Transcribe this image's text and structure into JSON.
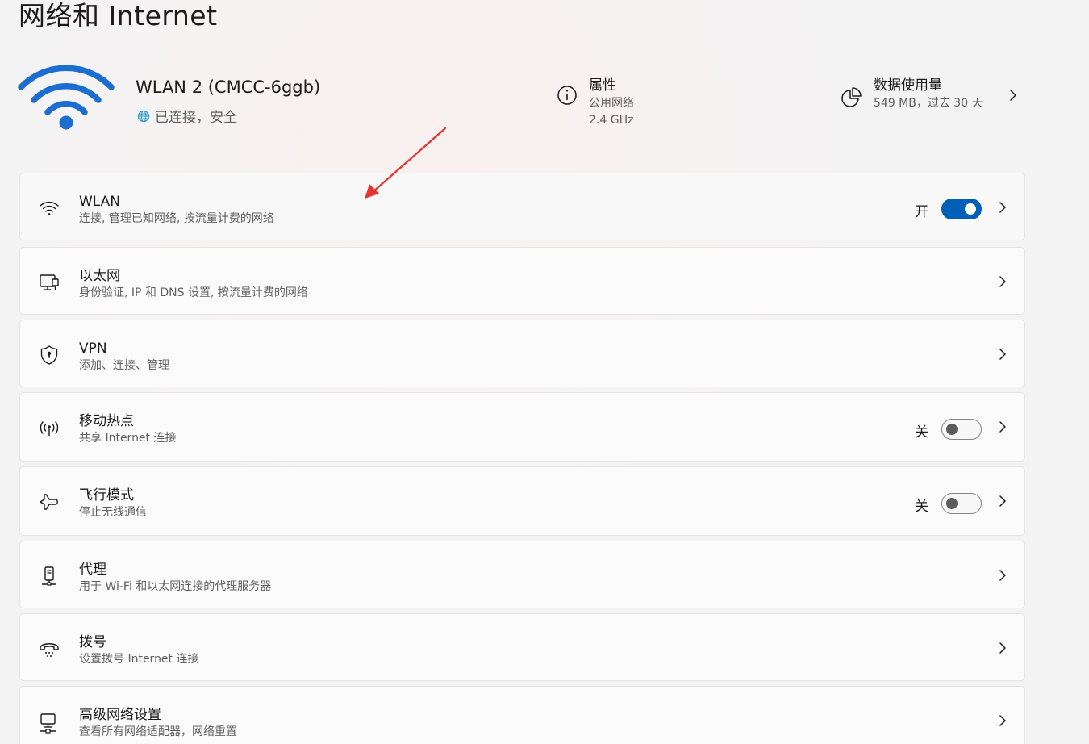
{
  "page": {
    "title": "网络和 Internet"
  },
  "network": {
    "name": "WLAN 2 (CMCC-6ggb)",
    "status": "已连接，安全"
  },
  "properties": {
    "title": "属性",
    "line1": "公用网络",
    "line2": "2.4 GHz"
  },
  "usage": {
    "title": "数据使用量",
    "detail": "549 MB，过去 30 天"
  },
  "items": [
    {
      "title": "WLAN",
      "subtitle": "连接, 管理已知网络, 按流量计费的网络",
      "icon": "wifi-icon",
      "toggle_label": "开",
      "toggle_on": true
    },
    {
      "title": "以太网",
      "subtitle": "身份验证, IP 和 DNS 设置, 按流量计费的网络",
      "icon": "ethernet-icon"
    },
    {
      "title": "VPN",
      "subtitle": "添加、连接、管理",
      "icon": "shield-icon"
    },
    {
      "title": "移动热点",
      "subtitle": "共享 Internet 连接",
      "icon": "hotspot-icon",
      "toggle_label": "关",
      "toggle_on": false
    },
    {
      "title": "飞行模式",
      "subtitle": "停止无线通信",
      "icon": "airplane-icon",
      "toggle_label": "关",
      "toggle_on": false
    },
    {
      "title": "代理",
      "subtitle": "用于 Wi-Fi 和以太网连接的代理服务器",
      "icon": "proxy-icon"
    },
    {
      "title": "拨号",
      "subtitle": "设置拨号 Internet 连接",
      "icon": "dialup-icon"
    },
    {
      "title": "高级网络设置",
      "subtitle": "查看所有网络适配器，网络重置",
      "icon": "advanced-network-icon"
    }
  ],
  "colors": {
    "accent": "#005fb8",
    "wifi_blue": "#1c6dd0",
    "annotation_arrow": "#e8322e"
  }
}
